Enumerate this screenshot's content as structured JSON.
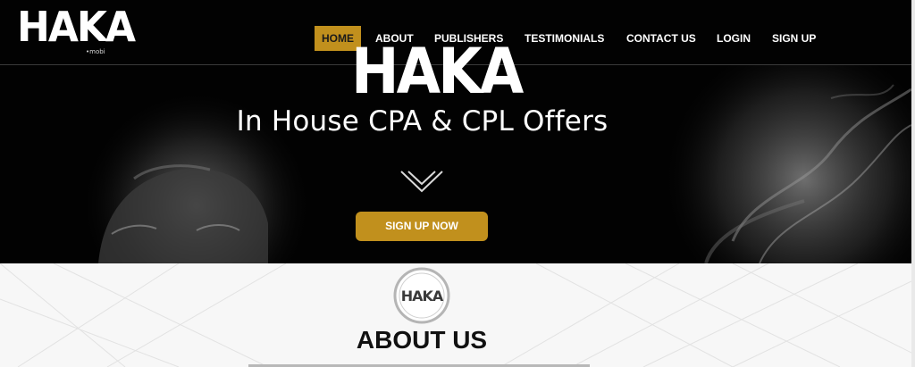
{
  "brand": {
    "logo_text": "HAKA",
    "logo_sub": "•mobi"
  },
  "nav": {
    "items": [
      {
        "label": "HOME",
        "active": true
      },
      {
        "label": "ABOUT",
        "active": false
      },
      {
        "label": "PUBLISHERS",
        "active": false
      },
      {
        "label": "TESTIMONIALS",
        "active": false
      },
      {
        "label": "CONTACT US",
        "active": false
      },
      {
        "label": "LOGIN",
        "active": false
      },
      {
        "label": "SIGN UP",
        "active": false
      }
    ]
  },
  "hero": {
    "brand": "HAKA",
    "tagline": "In House CPA & CPL Offers",
    "chevron_icon": "double-chevron-down-icon",
    "cta_label": "SIGN UP NOW"
  },
  "about": {
    "badge_text": "HAKA",
    "heading": "ABOUT US"
  },
  "colors": {
    "accent": "#c1901d",
    "hero_bg": "#020202",
    "about_bg": "#f7f7f7",
    "text_dark": "#111111"
  }
}
